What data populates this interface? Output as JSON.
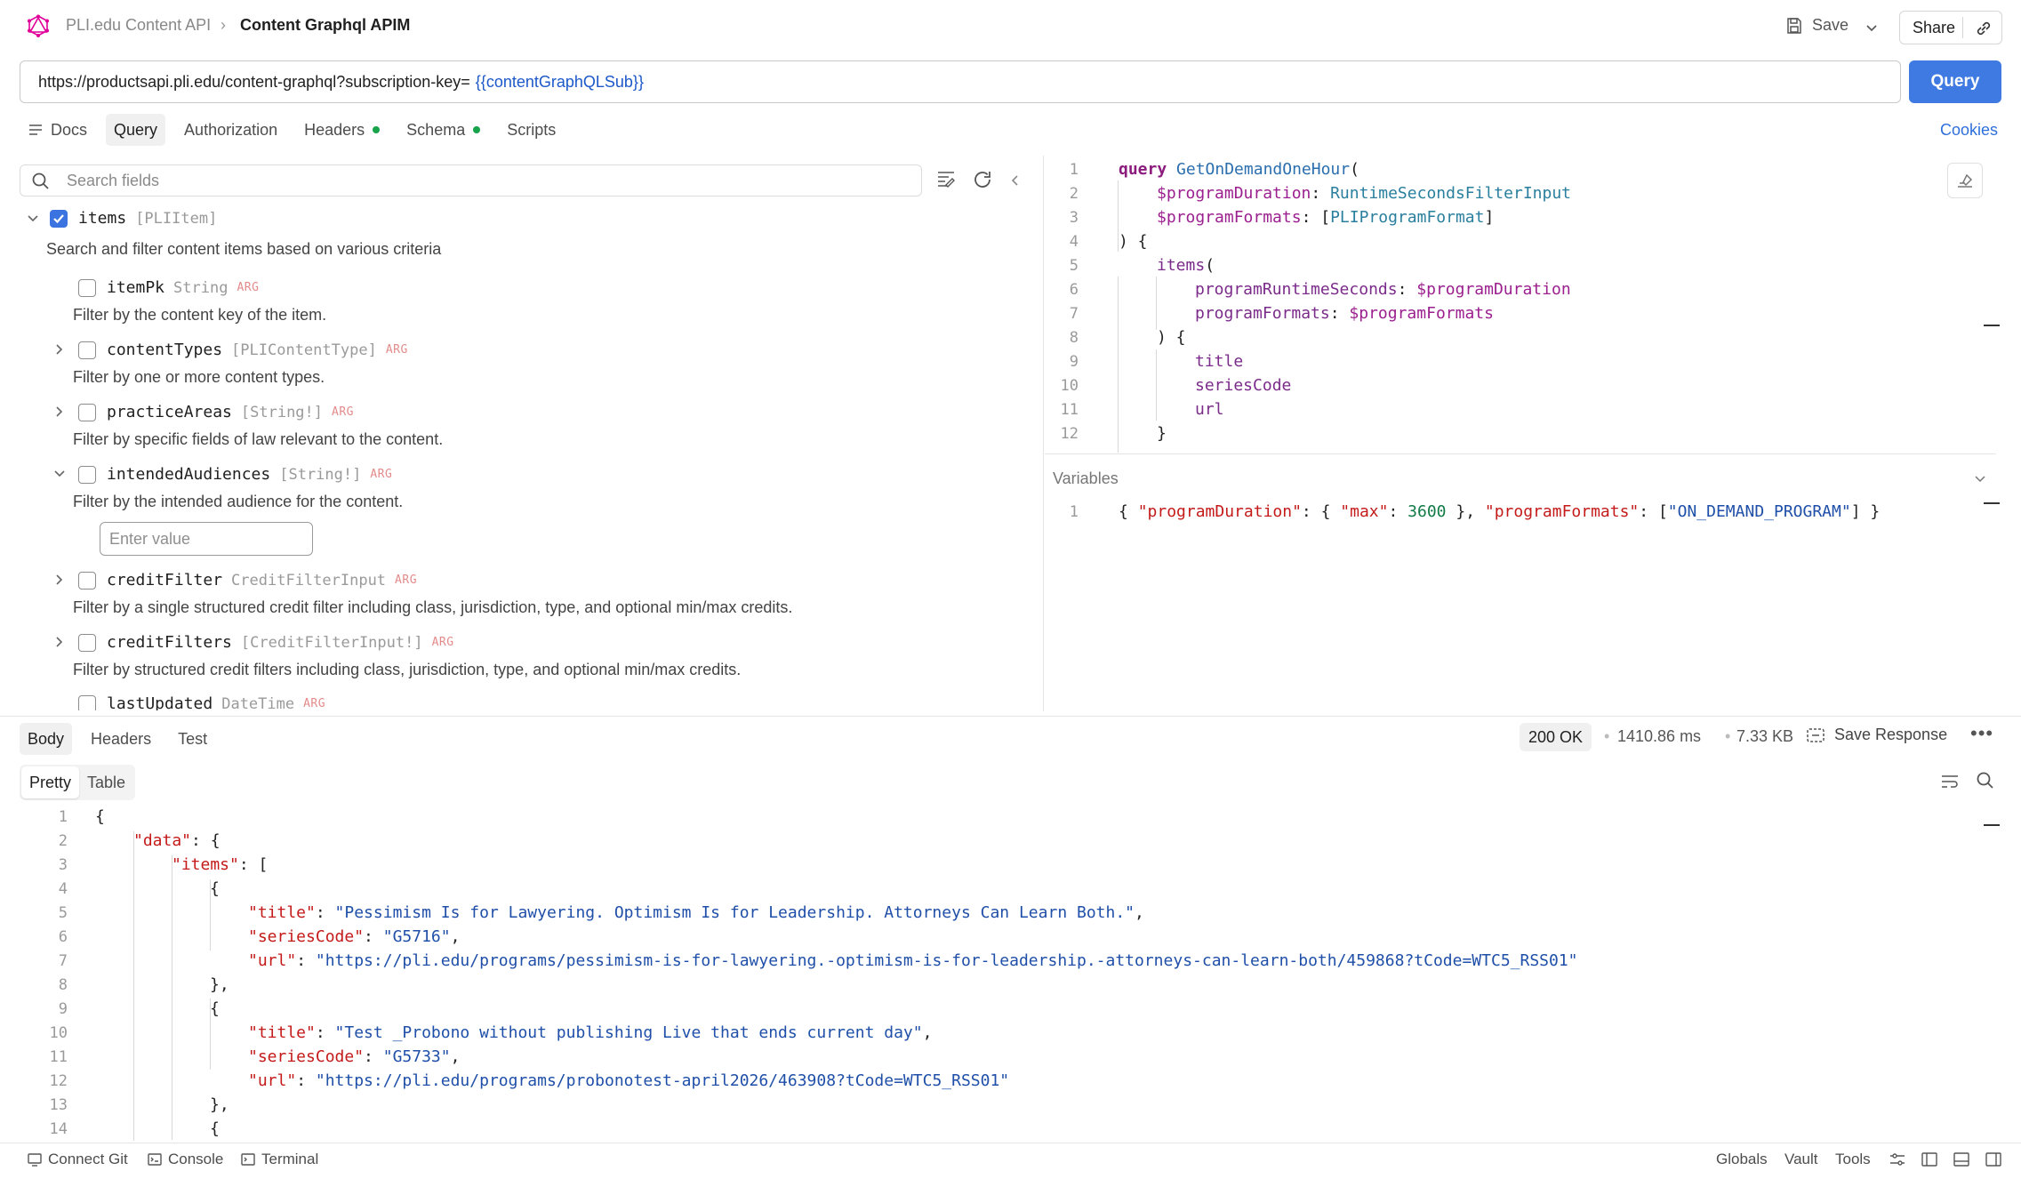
{
  "header": {
    "breadcrumb_parent": "PLI.edu Content API",
    "breadcrumb_current": "Content Graphql APIM",
    "save_label": "Save",
    "share_label": "Share"
  },
  "url": {
    "value": "https://productsapi.pli.edu/content-graphql?subscription-key=",
    "variable": "{{contentGraphQLSub}}",
    "query_button": "Query"
  },
  "request_tabs": [
    {
      "label": "Docs"
    },
    {
      "label": "Query"
    },
    {
      "label": "Authorization"
    },
    {
      "label": "Headers"
    },
    {
      "label": "Schema"
    },
    {
      "label": "Scripts"
    }
  ],
  "cookies_label": "Cookies",
  "schema": {
    "search_placeholder": "Search fields",
    "root": {
      "name": "items",
      "type": "[PLIItem]",
      "description": "Search and filter content items based on various criteria"
    },
    "args": [
      {
        "name": "itemPk",
        "type": "String",
        "tag": "ARG",
        "description": "Filter by the content key of the item."
      },
      {
        "name": "contentTypes",
        "type": "[PLIContentType]",
        "tag": "ARG",
        "description": "Filter by one or more content types."
      },
      {
        "name": "practiceAreas",
        "type": "[String!]",
        "tag": "ARG",
        "description": "Filter by specific fields of law relevant to the content."
      },
      {
        "name": "intendedAudiences",
        "type": "[String!]",
        "tag": "ARG",
        "description": "Filter by the intended audience for the content."
      },
      {
        "name": "creditFilter",
        "type": "CreditFilterInput",
        "tag": "ARG",
        "description": "Filter by a single structured credit filter including class, jurisdiction, type, and optional min/max credits."
      },
      {
        "name": "creditFilters",
        "type": "[CreditFilterInput!]",
        "tag": "ARG",
        "description": "Filter by structured credit filters including class, jurisdiction, type, and optional min/max credits."
      },
      {
        "name": "lastUpdated",
        "type": "DateTime",
        "tag": "ARG",
        "description": ""
      }
    ],
    "enter_value_placeholder": "Enter value"
  },
  "query_editor": {
    "line_numbers": [
      "1",
      "2",
      "3",
      "4",
      "5",
      "6",
      "7",
      "8",
      "9",
      "10",
      "11",
      "12"
    ],
    "kw_query": "query",
    "op_name": "GetOnDemandOneHour",
    "var1": "$programDuration",
    "var1_type": "RuntimeSecondsFilterInput",
    "var2": "$programFormats",
    "var2_type": "PLIProgramFormat",
    "items": "items",
    "arg1": "programRuntimeSeconds",
    "arg2": "programFormats",
    "f1": "title",
    "f2": "seriesCode",
    "f3": "url"
  },
  "variables": {
    "label": "Variables",
    "line": "1",
    "k1": "\"programDuration\"",
    "k2": "\"max\"",
    "v2": "3600",
    "k3": "\"programFormats\"",
    "v3": "\"ON_DEMAND_PROGRAM\""
  },
  "response": {
    "tabs": [
      {
        "label": "Body"
      },
      {
        "label": "Headers"
      },
      {
        "label": "Test"
      }
    ],
    "status": "200 OK",
    "time": "1410.86 ms",
    "size": "7.33 KB",
    "save_response": "Save Response",
    "view_tabs": [
      {
        "label": "Pretty"
      },
      {
        "label": "Table"
      }
    ],
    "line_numbers": [
      "1",
      "2",
      "3",
      "4",
      "5",
      "6",
      "7",
      "8",
      "9",
      "10",
      "11",
      "12",
      "13",
      "14"
    ],
    "k_data": "\"data\"",
    "k_items": "\"items\"",
    "k_title": "\"title\"",
    "k_series": "\"seriesCode\"",
    "k_url": "\"url\"",
    "item1": {
      "title": "\"Pessimism Is for Lawyering. Optimism Is for Leadership. Attorneys Can Learn Both.\"",
      "seriesCode": "\"G5716\"",
      "url": "\"https://pli.edu/programs/pessimism-is-for-lawyering.-optimism-is-for-leadership.-attorneys-can-learn-both/459868?tCode=WTC5_RSS01\""
    },
    "item2": {
      "title": "\"Test _Probono without publishing Live that ends current day\"",
      "seriesCode": "\"G5733\"",
      "url": "\"https://pli.edu/programs/probonotest-april2026/463908?tCode=WTC5_RSS01\""
    }
  },
  "footer": {
    "connect_git": "Connect Git",
    "console": "Console",
    "terminal": "Terminal",
    "globals": "Globals",
    "vault": "Vault",
    "tools": "Tools"
  },
  "colors": {
    "accent": "#3f7ae3",
    "status_green": "#16a34a",
    "logo_pink": "#e10098"
  }
}
